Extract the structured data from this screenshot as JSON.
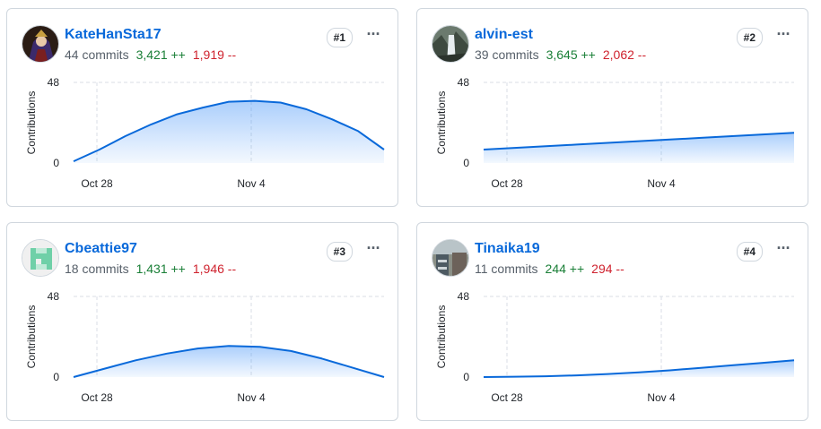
{
  "accent": "#0969da",
  "add_color": "#1a7f37",
  "del_color": "#cf222e",
  "contributors": [
    {
      "username": "KateHanSta17",
      "commits": "44 commits",
      "additions": "3,421 ++",
      "deletions": "1,919 --",
      "rank": "#1",
      "more_icon": "kebab-horizontal-icon",
      "chart_data": {
        "type": "area",
        "xlabel": "",
        "ylabel": "Contributions",
        "ylim": [
          0,
          48
        ],
        "yticks": [
          "0",
          "48"
        ],
        "xticks": [
          "Oct 28",
          "Nov 4"
        ],
        "values": [
          1,
          8,
          16,
          23,
          29,
          33,
          36.5,
          37,
          36,
          32,
          26,
          19,
          8
        ]
      }
    },
    {
      "username": "alvin-est",
      "commits": "39 commits",
      "additions": "3,645 ++",
      "deletions": "2,062 --",
      "rank": "#2",
      "more_icon": "kebab-horizontal-icon",
      "chart_data": {
        "type": "area",
        "xlabel": "",
        "ylabel": "Contributions",
        "ylim": [
          0,
          48
        ],
        "yticks": [
          "0",
          "48"
        ],
        "xticks": [
          "Oct 28",
          "Nov 4"
        ],
        "values": [
          8,
          9,
          10,
          11,
          12,
          13,
          14,
          15,
          16,
          17,
          18
        ]
      }
    },
    {
      "username": "Cbeattie97",
      "commits": "18 commits",
      "additions": "1,431 ++",
      "deletions": "1,946 --",
      "rank": "#3",
      "more_icon": "kebab-horizontal-icon",
      "chart_data": {
        "type": "area",
        "xlabel": "",
        "ylabel": "Contributions",
        "ylim": [
          0,
          48
        ],
        "yticks": [
          "0",
          "48"
        ],
        "xticks": [
          "Oct 28",
          "Nov 4"
        ],
        "values": [
          0,
          5,
          10,
          14,
          17,
          18.5,
          18,
          15.5,
          11,
          5.5,
          0
        ]
      }
    },
    {
      "username": "Tinaika19",
      "commits": "11 commits",
      "additions": "244 ++",
      "deletions": "294 --",
      "rank": "#4",
      "more_icon": "kebab-horizontal-icon",
      "chart_data": {
        "type": "area",
        "xlabel": "",
        "ylabel": "Contributions",
        "ylim": [
          0,
          48
        ],
        "yticks": [
          "0",
          "48"
        ],
        "xticks": [
          "Oct 28",
          "Nov 4"
        ],
        "values": [
          0,
          0.2,
          0.5,
          1,
          1.8,
          2.8,
          4,
          5.5,
          7,
          8.5,
          10
        ]
      }
    }
  ]
}
